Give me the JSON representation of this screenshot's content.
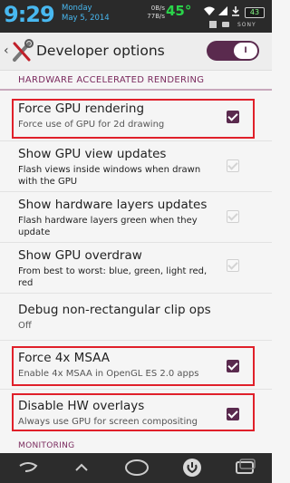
{
  "status_bar": {
    "time": "9:29",
    "day": "Monday",
    "date": "May 5, 2014",
    "net_up": "0B/s",
    "net_down": "77B/s",
    "temperature": "45°",
    "battery": "43",
    "brand": "SONY"
  },
  "action_bar": {
    "title": "Developer options",
    "toggle_label": "I",
    "toggle_on": true
  },
  "sections": {
    "hardware": "HARDWARE ACCELERATED RENDERING",
    "monitoring": "MONITORING"
  },
  "prefs": [
    {
      "title": "Force GPU rendering",
      "summary": "Force use of GPU for 2d drawing",
      "checked": true,
      "enabled": true
    },
    {
      "title": "Show GPU view updates",
      "summary": "Flash views inside windows when drawn with the GPU",
      "checked": true,
      "enabled": false
    },
    {
      "title": "Show hardware layers updates",
      "summary": "Flash hardware layers green when they update",
      "checked": true,
      "enabled": false
    },
    {
      "title": "Show GPU overdraw",
      "summary": "From best to worst: blue, green, light red, red",
      "checked": true,
      "enabled": false
    },
    {
      "title": "Debug non-rectangular clip ops",
      "summary": "Off"
    },
    {
      "title": "Force 4x MSAA",
      "summary": "Enable 4x MSAA in OpenGL ES 2.0 apps",
      "checked": true,
      "enabled": true
    },
    {
      "title": "Disable HW overlays",
      "summary": "Always use GPU for screen compositing",
      "checked": true,
      "enabled": true
    }
  ],
  "colors": {
    "accent": "#5a2a4e",
    "highlight": "#e0202a",
    "clock": "#48b8f0"
  }
}
